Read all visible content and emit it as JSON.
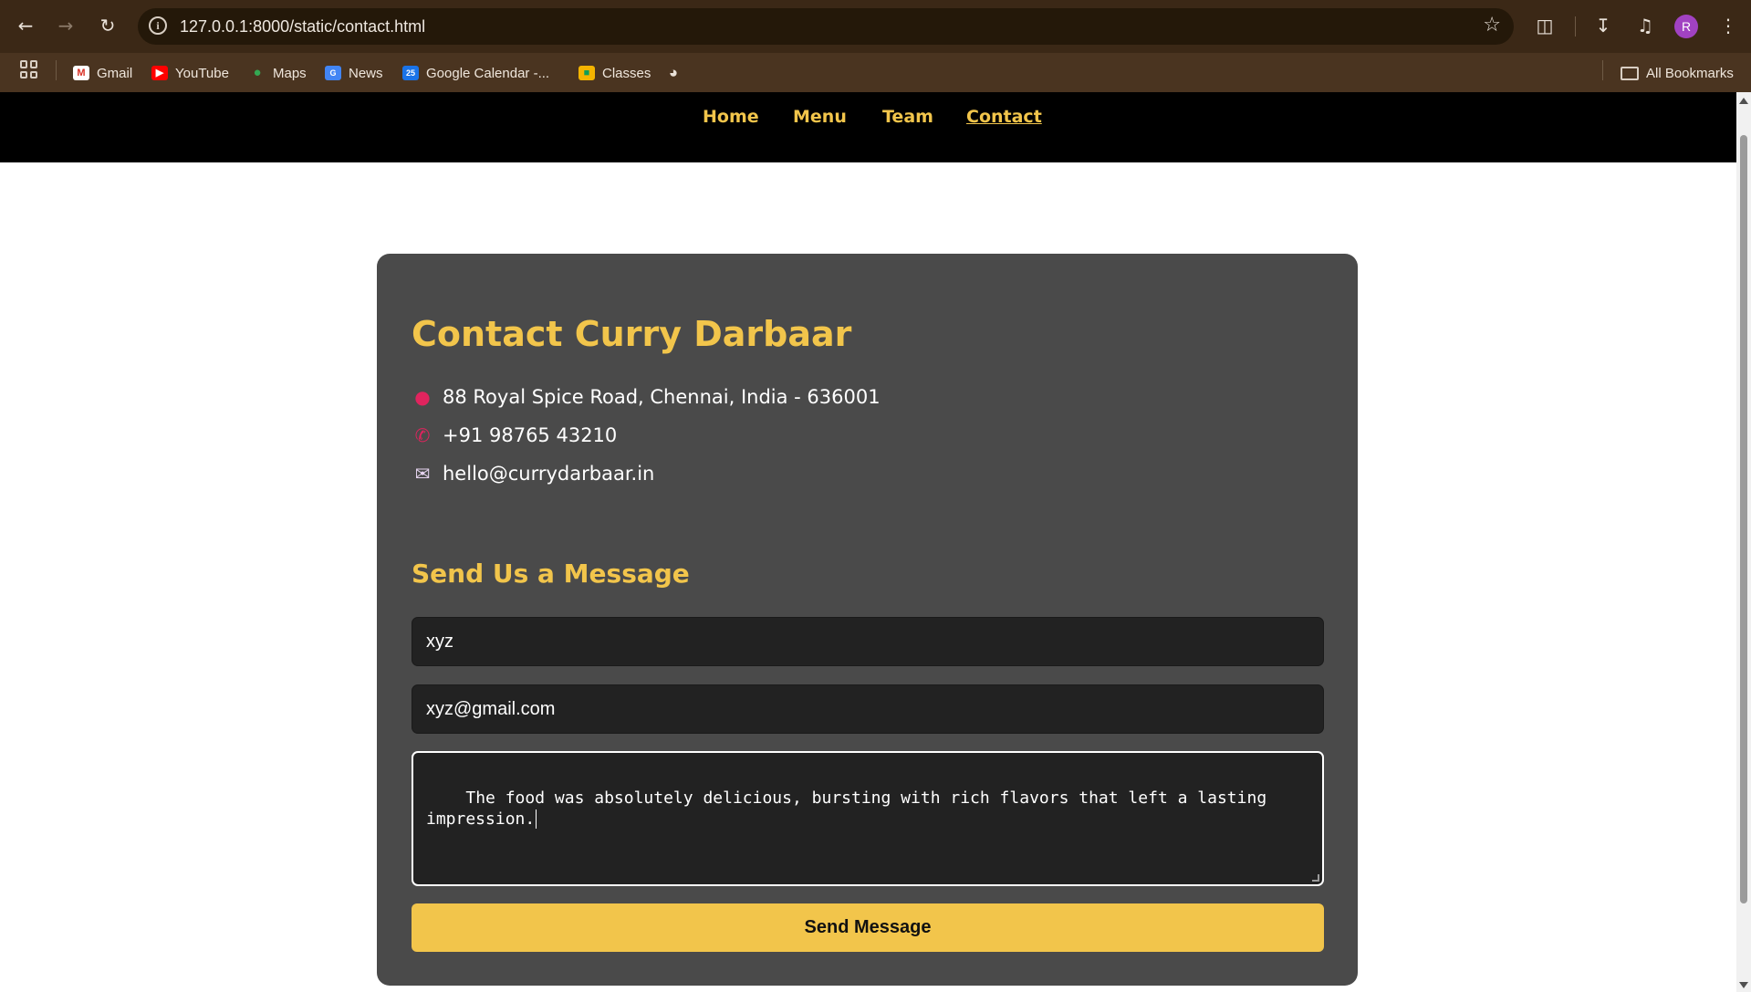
{
  "browser": {
    "url": "127.0.0.1:8000/static/contact.html",
    "bookmarks": [
      {
        "label": "Gmail",
        "icon": "gmail-icon"
      },
      {
        "label": "YouTube",
        "icon": "youtube-icon"
      },
      {
        "label": "Maps",
        "icon": "maps-icon"
      },
      {
        "label": "News",
        "icon": "news-icon"
      },
      {
        "label": "Google Calendar -...",
        "icon": "calendar-icon"
      },
      {
        "label": "Classes",
        "icon": "classroom-icon"
      }
    ],
    "all_bookmarks": "All Bookmarks",
    "profile_initial": "R",
    "calendar_day": "25"
  },
  "nav": {
    "links": [
      "Home",
      "Menu",
      "Team",
      "Contact"
    ],
    "active": "Contact"
  },
  "contact": {
    "title": "Contact Curry Darbaar",
    "address": "88 Royal Spice Road, Chennai, India - 636001",
    "phone": "+91 98765 43210",
    "email": "hello@currydarbaar.in",
    "icons": [
      "pin-icon",
      "phone-icon",
      "envelope-icon"
    ]
  },
  "form": {
    "heading": "Send Us a Message",
    "name_value": "xyz",
    "email_value": "xyz@gmail.com",
    "message_value": "The food was absolutely delicious, bursting with rich flavors that left a lasting\nimpression.",
    "submit_label": "Send Message"
  },
  "colors": {
    "accent": "#f2c54b",
    "card": "#4a4a4a",
    "field": "#222222",
    "nav_bg": "#000000"
  }
}
